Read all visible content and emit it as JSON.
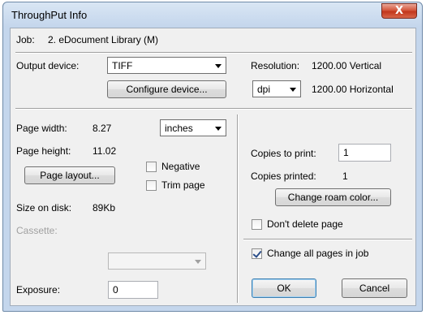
{
  "window": {
    "title": "ThroughPut Info",
    "close_glyph": "X"
  },
  "job": {
    "label": "Job:",
    "value": "2. eDocument Library (M)"
  },
  "output": {
    "label": "Output device:",
    "device_value": "TIFF",
    "configure_label": "Configure device...",
    "resolution_label": "Resolution:",
    "resolution_vertical": "1200.00 Vertical",
    "resolution_unit": "dpi",
    "resolution_horizontal": "1200.00 Horizontal"
  },
  "page": {
    "width_label": "Page width:",
    "width_value": "8.27",
    "unit_value": "inches",
    "height_label": "Page height:",
    "height_value": "11.02",
    "layout_label": "Page layout...",
    "negative_label": "Negative",
    "negative_checked": false,
    "trim_label": "Trim page",
    "trim_checked": false,
    "size_label": "Size on disk:",
    "size_value": "89Kb",
    "cassette_label": "Cassette:",
    "cassette_value": "",
    "exposure_label": "Exposure:",
    "exposure_value": "0"
  },
  "copies": {
    "to_print_label": "Copies to print:",
    "to_print_value": "1",
    "printed_label": "Copies printed:",
    "printed_value": "1",
    "roam_color_label": "Change roam color...",
    "dont_delete_label": "Don't delete page",
    "dont_delete_checked": false,
    "change_all_label": "Change all pages in job",
    "change_all_checked": true
  },
  "buttons": {
    "ok": "OK",
    "cancel": "Cancel"
  }
}
